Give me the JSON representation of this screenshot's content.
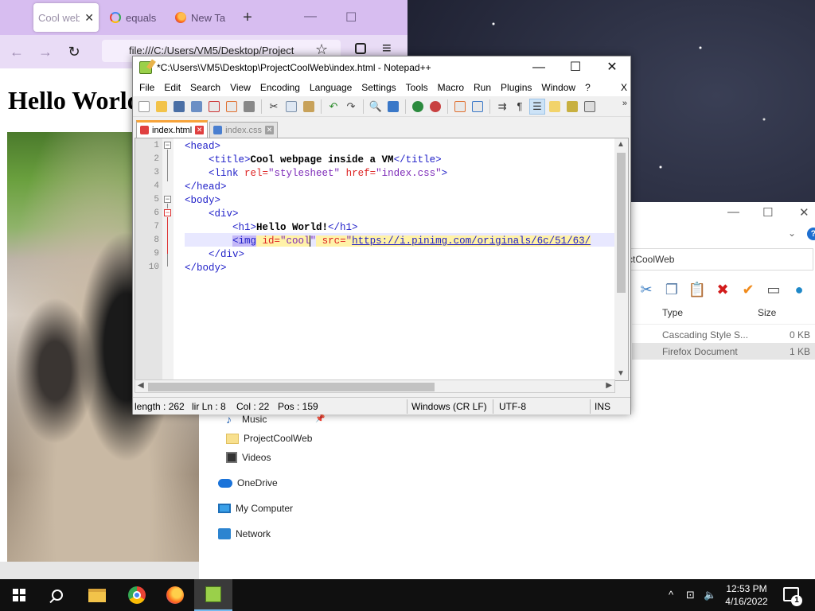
{
  "firefox": {
    "tabs": [
      {
        "label": "Cool web",
        "close": "✕"
      },
      {
        "label": "equals"
      },
      {
        "label": "New Ta"
      }
    ],
    "new_tab": "+",
    "url": "file:///C:/Users/VM5/Desktop/Project",
    "page_heading": "Hello World",
    "win_minimize": "—",
    "win_maximize": "☐",
    "back": "←",
    "forward": "→",
    "reload": "↻",
    "bookmark": "☆",
    "menu": "≡"
  },
  "explorer": {
    "path_partial": "ctCoolWeb",
    "columns": {
      "type": "Type",
      "size": "Size"
    },
    "rows": [
      {
        "type": "Cascading Style S...",
        "size": "0 KB"
      },
      {
        "type": "Firefox Document",
        "size": "1 KB"
      }
    ],
    "nav": [
      {
        "label": "Music",
        "icon": "music-icon"
      },
      {
        "label": "ProjectCoolWeb",
        "icon": "folder-icon"
      },
      {
        "label": "Videos",
        "icon": "videos-icon"
      },
      {
        "label": "OneDrive",
        "icon": "onedrive-icon"
      },
      {
        "label": "My Computer",
        "icon": "computer-icon"
      },
      {
        "label": "Network",
        "icon": "network-icon"
      }
    ],
    "win_min": "—",
    "win_max": "☐",
    "win_close": "✕",
    "help": "?",
    "chevron": "⌄"
  },
  "notepad": {
    "title": "*C:\\Users\\VM5\\Desktop\\ProjectCoolWeb\\index.html - Notepad++",
    "win_min": "—",
    "win_max": "☐",
    "win_close": "✕",
    "menu": [
      "File",
      "Edit",
      "Search",
      "View",
      "Encoding",
      "Language",
      "Settings",
      "Tools",
      "Macro",
      "Run",
      "Plugins",
      "Window",
      "?"
    ],
    "menu_close": "X",
    "tabs": [
      {
        "label": "index.html"
      },
      {
        "label": "index.css"
      }
    ],
    "line_numbers": [
      "1",
      "2",
      "3",
      "4",
      "5",
      "6",
      "7",
      "8",
      "9",
      "10"
    ],
    "code": {
      "l1_tag": "<head>",
      "l2_open": "<title>",
      "l2_text": "Cool webpage inside a VM",
      "l2_close": "</title>",
      "l3_tag": "<link",
      "l3_attr1": " rel=",
      "l3_val1": "\"stylesheet\"",
      "l3_attr2": " href=",
      "l3_val2": "\"index.css\"",
      "l3_end": ">",
      "l4_tag": "</head>",
      "l5_tag": "<body>",
      "l6_tag": "<div>",
      "l7_open": "<h1>",
      "l7_text": "Hello World!",
      "l7_close": "</h1>",
      "l8_tag": "<img",
      "l8_attr1": " id=",
      "l8_val1a": "\"cool",
      "l8_val1b": "\"",
      "l8_attr2": " src=",
      "l8_quote": "\"",
      "l8_link": "https://i.pinimg.com/originals/6c/51/63/",
      "l9_tag": "</div>",
      "l10_tag": "</body>"
    },
    "status": {
      "length": "length : 262",
      "lines": "lir Ln : 8",
      "col": "Col : 22",
      "pos": "Pos : 159",
      "eol": "Windows (CR LF)",
      "encoding": "UTF-8",
      "mode": "INS"
    }
  },
  "taskbar": {
    "time": "12:53 PM",
    "date": "4/16/2022",
    "notification_count": "1",
    "tray_chevron": "^",
    "tray_network": "⊡",
    "tray_volume": "🔈"
  },
  "colors": {
    "firefox_tabbar": "#d7bdf0",
    "npp_tab_accent": "#f7a33a",
    "taskbar": "#101010"
  }
}
